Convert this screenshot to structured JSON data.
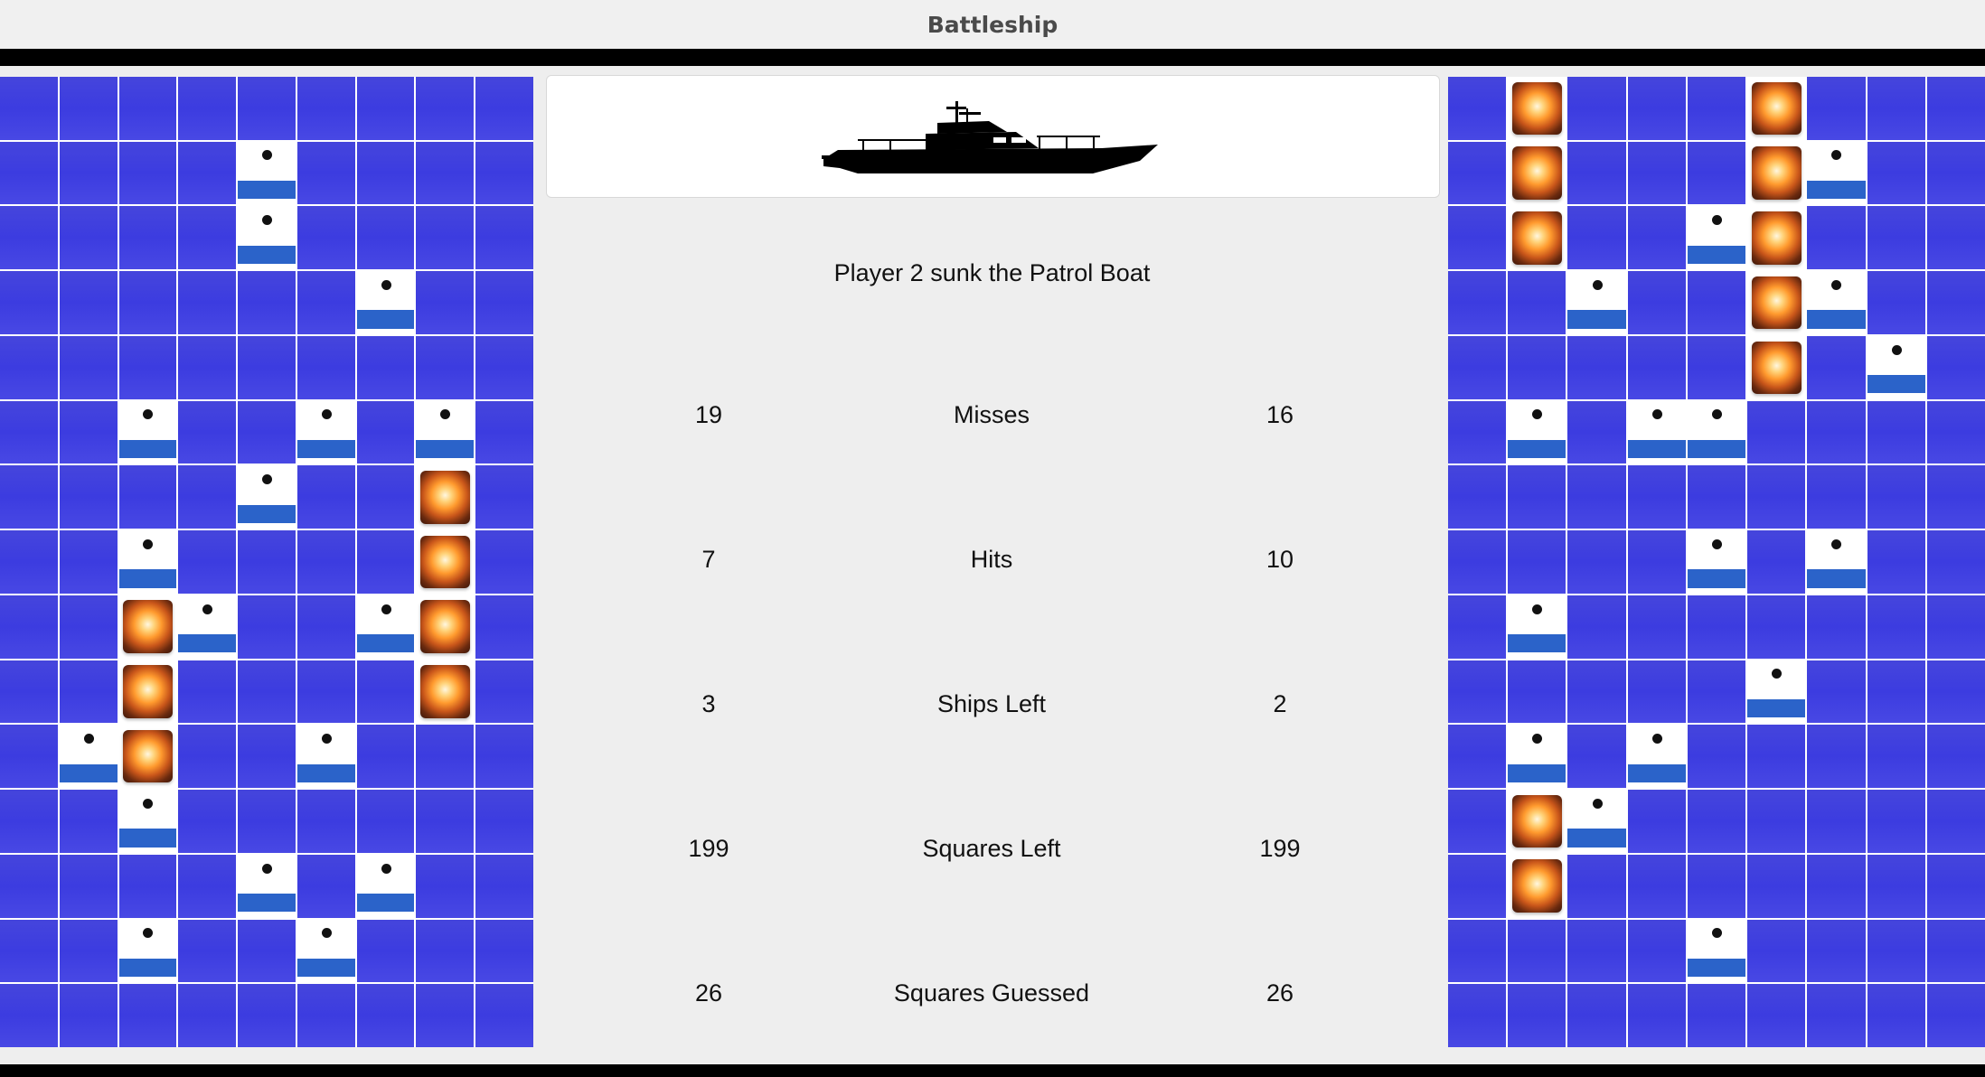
{
  "window": {
    "title": "Battleship"
  },
  "status_message": "Player 2 sunk the Patrol Boat",
  "stats": [
    {
      "label": "Misses",
      "player1": "19",
      "player2": "16"
    },
    {
      "label": "Hits",
      "player1": "7",
      "player2": "10"
    },
    {
      "label": "Ships Left",
      "player1": "3",
      "player2": "2"
    },
    {
      "label": "Squares Left",
      "player1": "199",
      "player2": "199"
    },
    {
      "label": "Squares Guessed",
      "player1": "26",
      "player2": "26"
    }
  ],
  "boards": {
    "columns": 9,
    "rows": 15,
    "left": {
      "misses": [
        [
          1,
          4
        ],
        [
          2,
          4
        ],
        [
          3,
          6
        ],
        [
          5,
          2
        ],
        [
          5,
          5
        ],
        [
          5,
          7
        ],
        [
          6,
          4
        ],
        [
          7,
          2
        ],
        [
          8,
          3
        ],
        [
          8,
          6
        ],
        [
          10,
          1
        ],
        [
          10,
          5
        ],
        [
          11,
          2
        ],
        [
          12,
          4
        ],
        [
          12,
          6
        ],
        [
          13,
          2
        ],
        [
          13,
          5
        ]
      ],
      "hits": [
        [
          6,
          7
        ],
        [
          7,
          7
        ],
        [
          8,
          2
        ],
        [
          8,
          7
        ],
        [
          9,
          2
        ],
        [
          9,
          7
        ],
        [
          10,
          2
        ]
      ]
    },
    "right": {
      "misses": [
        [
          1,
          6
        ],
        [
          2,
          4
        ],
        [
          3,
          2
        ],
        [
          3,
          6
        ],
        [
          4,
          7
        ],
        [
          5,
          1
        ],
        [
          5,
          3
        ],
        [
          5,
          4
        ],
        [
          7,
          4
        ],
        [
          7,
          6
        ],
        [
          8,
          1
        ],
        [
          9,
          5
        ],
        [
          10,
          1
        ],
        [
          10,
          3
        ],
        [
          11,
          2
        ],
        [
          13,
          4
        ]
      ],
      "hits": [
        [
          0,
          1
        ],
        [
          0,
          5
        ],
        [
          1,
          1
        ],
        [
          1,
          5
        ],
        [
          2,
          1
        ],
        [
          2,
          5
        ],
        [
          3,
          5
        ],
        [
          4,
          5
        ],
        [
          11,
          1
        ],
        [
          12,
          1
        ]
      ]
    }
  },
  "icons": {
    "ship": "patrol-boat-silhouette",
    "miss": "splash-marker",
    "hit": "explosion"
  },
  "colors": {
    "water": "#3c3ce0",
    "splash": "#2b63c9",
    "background": "#eeeeee"
  }
}
